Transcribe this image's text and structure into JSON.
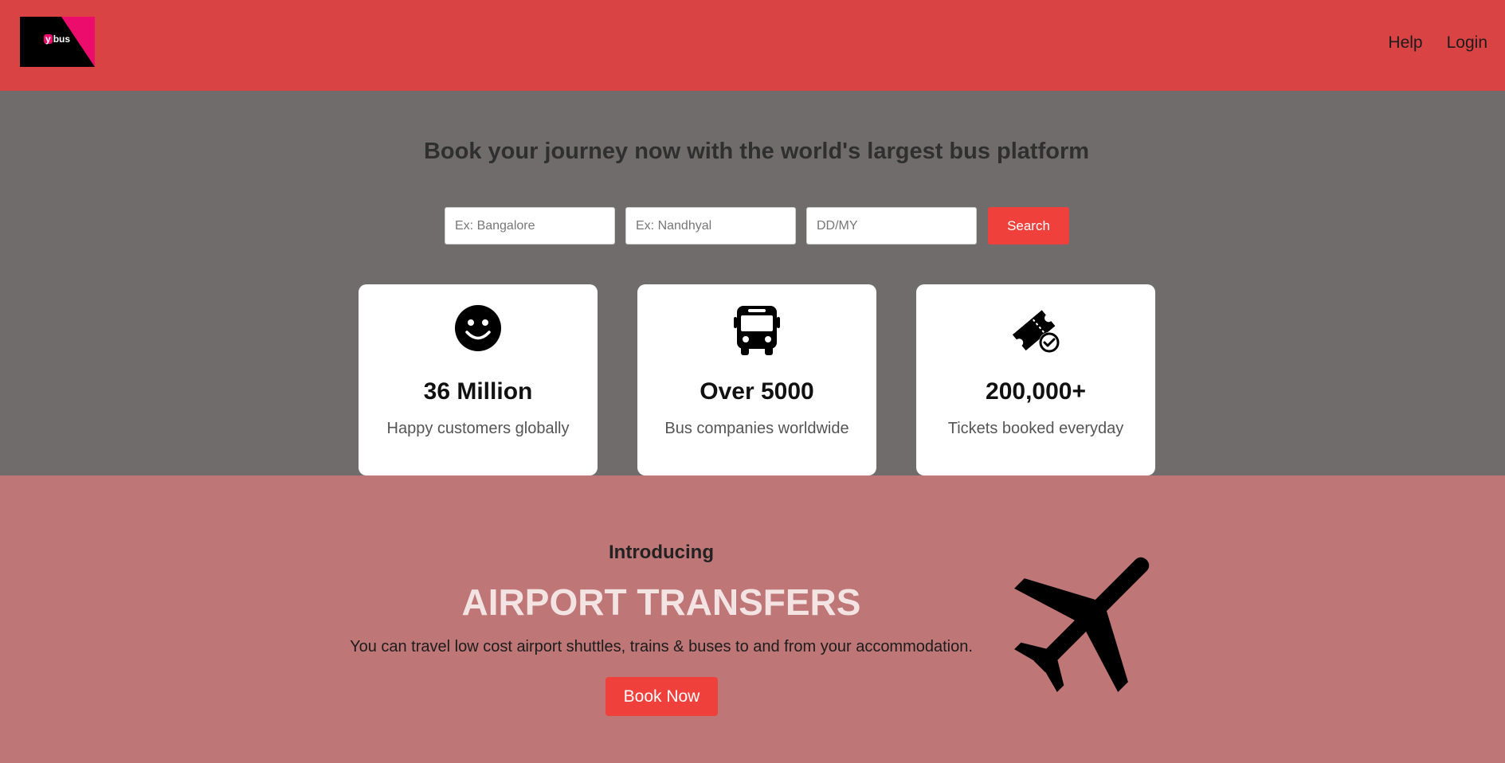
{
  "header": {
    "logo_text": "bus",
    "logo_letter": "y",
    "nav": [
      "Help",
      "Login"
    ]
  },
  "hero": {
    "title": "Book your journey now with the world's largest bus platform",
    "search": {
      "from_placeholder": "Ex: Bangalore",
      "to_placeholder": "Ex: Nandhyal",
      "date_placeholder": "DD/MY",
      "button_label": "Search"
    },
    "cards": [
      {
        "icon": "smiley-icon",
        "stat": "36 Million",
        "desc": "Happy customers globally"
      },
      {
        "icon": "bus-icon",
        "stat": "Over 5000",
        "desc": "Bus companies worldwide"
      },
      {
        "icon": "ticket-check-icon",
        "stat": "200,000+",
        "desc": "Tickets booked everyday"
      }
    ]
  },
  "airport": {
    "intro": "Introducing",
    "title": "AIRPORT TRANSFERS",
    "description": "You can travel low cost airport shuttles, trains & buses to and from your accommodation.",
    "button_label": "Book Now",
    "icon": "airplane-icon"
  },
  "colors": {
    "header_bg": "#d94344",
    "hero_bg": "#716c6c",
    "airport_bg": "#bf7677",
    "accent": "#ef403c",
    "logo_pink": "#ec0c6c"
  }
}
